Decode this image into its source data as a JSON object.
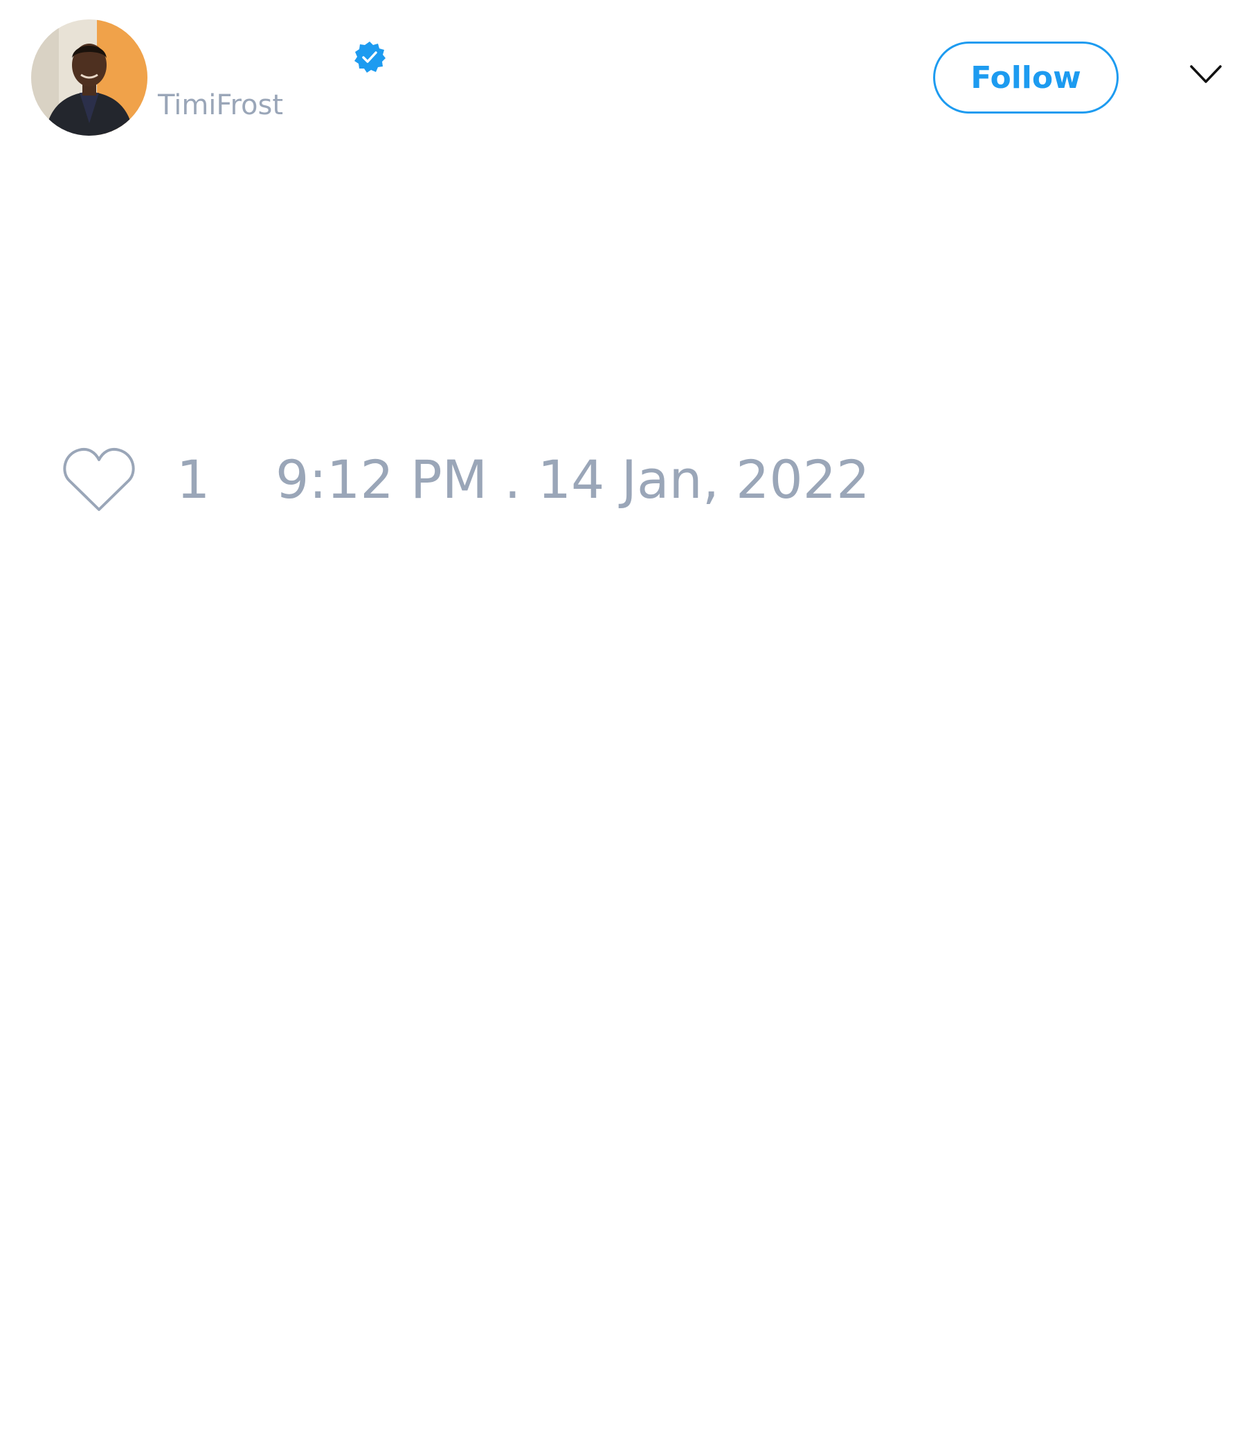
{
  "author": {
    "handle": "TimiFrost",
    "verified": true,
    "avatar_icon": "user-avatar-photo"
  },
  "header": {
    "follow_label": "Follow",
    "menu_icon": "chevron-down-icon"
  },
  "footer": {
    "like_icon": "heart-outline-icon",
    "like_count": "1",
    "timestamp": "9:12 PM . 14 Jan, 2022"
  },
  "colors": {
    "accent": "#1d9bf0",
    "muted_text": "#9aa6b8",
    "background": "#ffffff"
  }
}
